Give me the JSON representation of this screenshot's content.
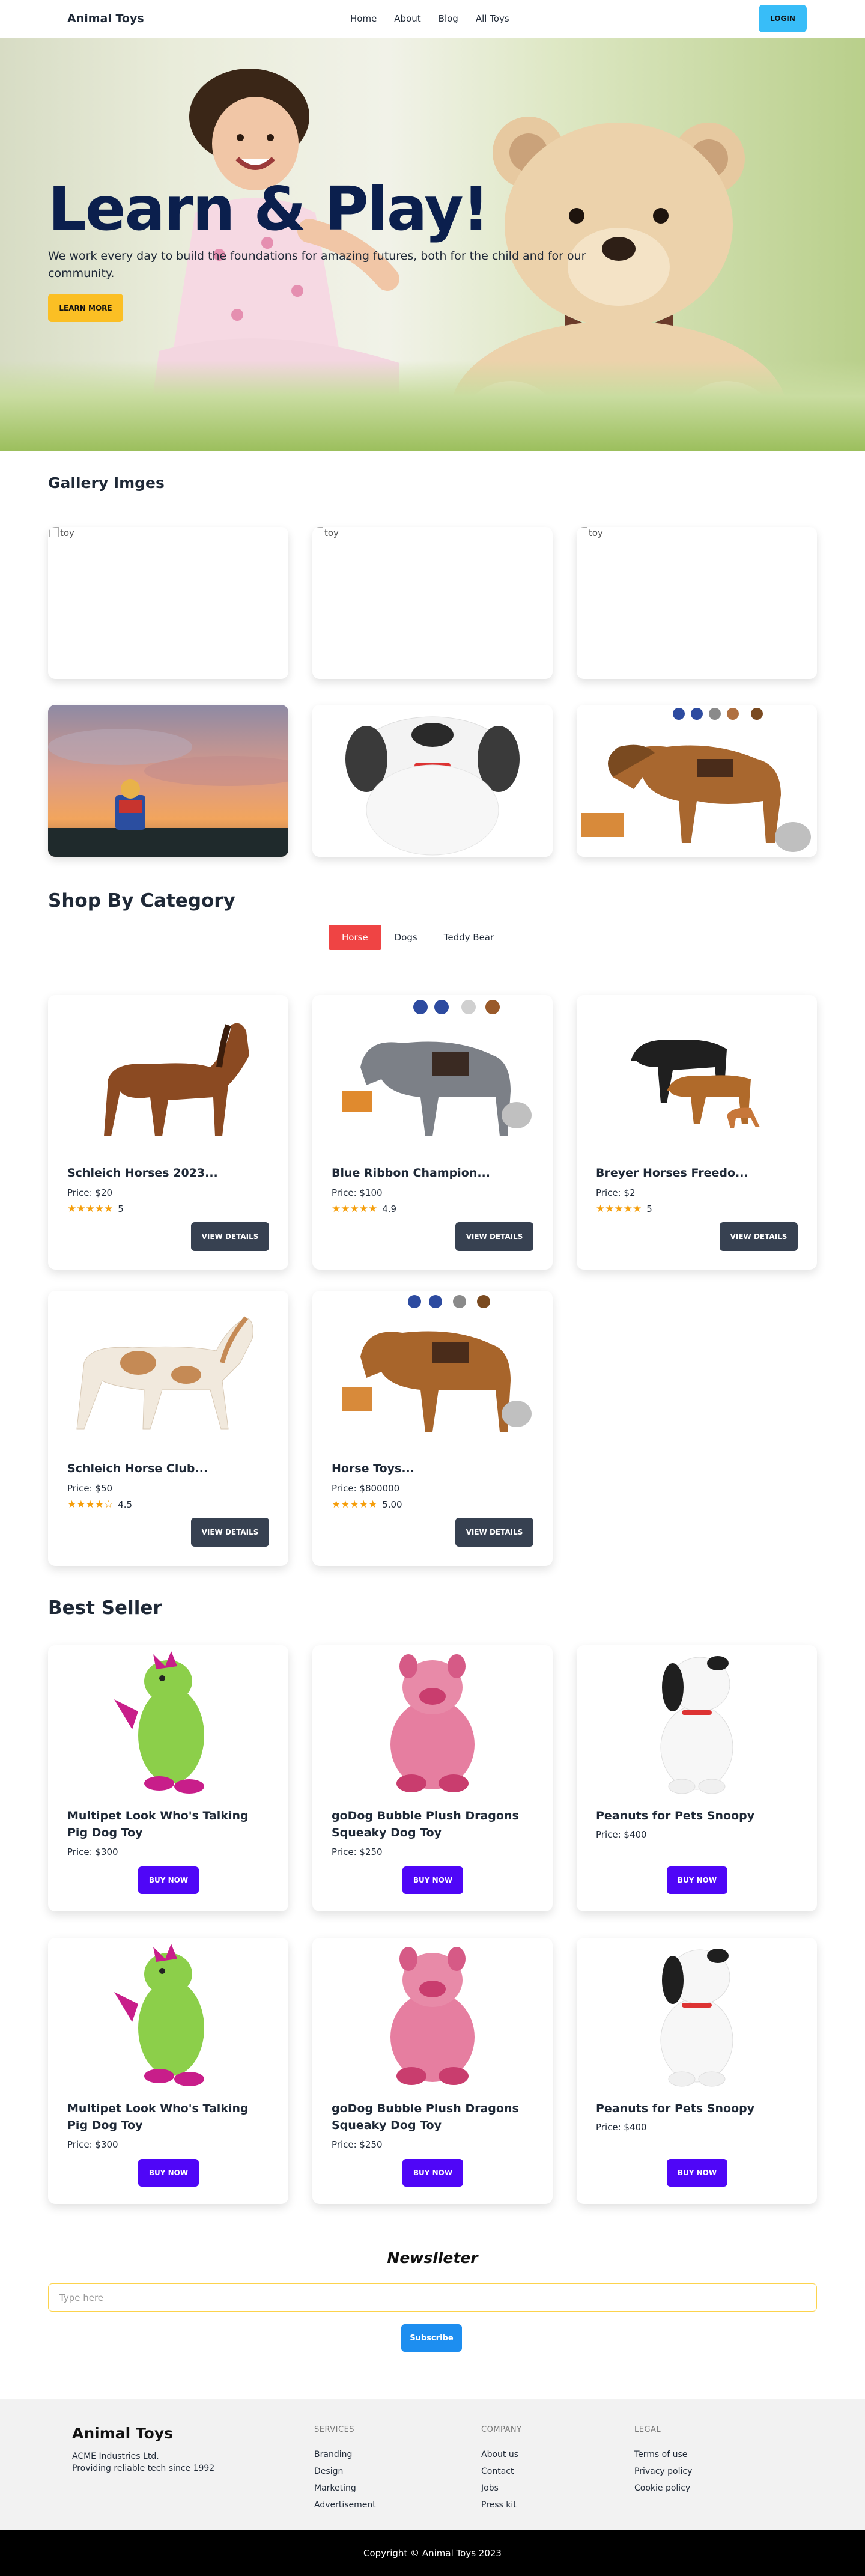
{
  "nav": {
    "brand": "Animal Toys",
    "links": [
      "Home",
      "About",
      "Blog",
      "All Toys"
    ],
    "login": "LOGIN"
  },
  "hero": {
    "title": "Learn & Play!",
    "subtitle": "We work every day to build the foundations for amazing futures, both for the child and for our community.",
    "button": "LEARN MORE"
  },
  "gallery": {
    "title": "Gallery Imges",
    "broken_alt": "toy"
  },
  "category": {
    "title": "Shop By Category",
    "tabs": [
      "Horse",
      "Dogs",
      "Teddy Bear"
    ],
    "active_tab": "Horse",
    "details_label": "VIEW DETAILS",
    "products": [
      {
        "name": "Schleich Horses 2023...",
        "price": "Price: $20",
        "rating": "5",
        "stars": 5
      },
      {
        "name": "Blue Ribbon Champion...",
        "price": "Price: $100",
        "rating": "4.9",
        "stars": 5
      },
      {
        "name": "Breyer Horses Freedo...",
        "price": "Price: $2",
        "rating": "5",
        "stars": 5
      },
      {
        "name": "Schleich Horse Club...",
        "price": "Price: $50",
        "rating": "4.5",
        "stars": 4.5
      },
      {
        "name": "Horse Toys...",
        "price": "Price: $800000",
        "rating": "5.00",
        "stars": 5
      }
    ]
  },
  "bestseller": {
    "title": "Best Seller",
    "buy_label": "BUY NOW",
    "products": [
      {
        "name": "Multipet Look Who's Talking Pig Dog Toy",
        "price": "Price: $300"
      },
      {
        "name": "goDog Bubble Plush Dragons Squeaky Dog Toy",
        "price": "Price: $250"
      },
      {
        "name": "Peanuts for Pets Snoopy",
        "price": "Price: $400"
      },
      {
        "name": "Multipet Look Who's Talking Pig Dog Toy",
        "price": "Price: $300"
      },
      {
        "name": "goDog Bubble Plush Dragons Squeaky Dog Toy",
        "price": "Price: $250"
      },
      {
        "name": "Peanuts for Pets Snoopy",
        "price": "Price: $400"
      }
    ]
  },
  "newsletter": {
    "title": "Newslleter",
    "placeholder": "Type here",
    "button": "Subscribe"
  },
  "footer": {
    "brand": "Animal Toys",
    "line1": "ACME Industries Ltd.",
    "line2": "Providing reliable tech since 1992",
    "services": {
      "title": "SERVICES",
      "items": [
        "Branding",
        "Design",
        "Marketing",
        "Advertisement"
      ]
    },
    "company": {
      "title": "COMPANY",
      "items": [
        "About us",
        "Contact",
        "Jobs",
        "Press kit"
      ]
    },
    "legal": {
      "title": "LEGAL",
      "items": [
        "Terms of use",
        "Privacy policy",
        "Cookie policy"
      ]
    },
    "copyright": "Copyright © Animal Toys 2023"
  }
}
